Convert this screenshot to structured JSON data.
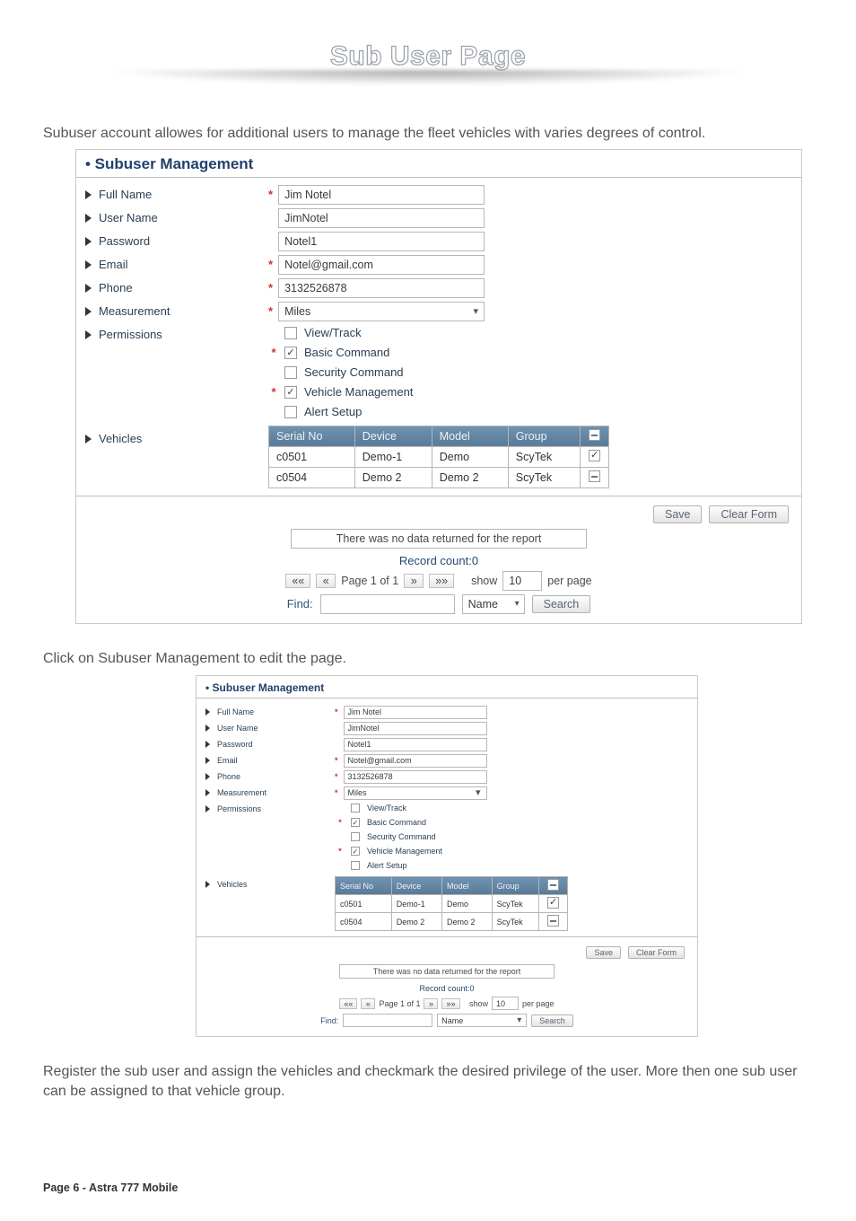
{
  "title": "Sub User Page",
  "intro": "Subuser account allowes for additional users to manage the fleet vehicles with varies degrees of control.",
  "mid_caption": "Click on Subuser Management to edit the page.",
  "outro": "Register the sub user and assign the vehicles and checkmark the desired privilege of the user. More then one sub user can be assigned to that vehicle group.",
  "footer": {
    "page_label": "Page 6  -  Astra 777 Mobile"
  },
  "shot": {
    "heading": "• Subuser Management",
    "fields": {
      "full_name": {
        "label": "Full Name",
        "value": "Jim Notel"
      },
      "user_name": {
        "label": "User Name",
        "value": "JimNotel"
      },
      "password": {
        "label": "Password",
        "value": "Notel1"
      },
      "email": {
        "label": "Email",
        "value": "Notel@gmail.com"
      },
      "phone": {
        "label": "Phone",
        "value": "3132526878"
      },
      "measurement": {
        "label": "Measurement",
        "value": "Miles"
      },
      "permissions_label": "Permissions"
    },
    "permissions": [
      {
        "label": "View/Track",
        "checked": false
      },
      {
        "label": "Basic Command",
        "checked": true
      },
      {
        "label": "Security Command",
        "checked": false
      },
      {
        "label": "Vehicle Management",
        "checked": true
      },
      {
        "label": "Alert Setup",
        "checked": false
      }
    ],
    "vehicles_label": "Vehicles",
    "vehicles": {
      "headers": {
        "serial": "Serial No",
        "device": "Device",
        "model": "Model",
        "group": "Group",
        "chk": ""
      },
      "rows": [
        {
          "serial": "c0501",
          "device": "Demo-1",
          "model": "Demo",
          "group": "ScyTek",
          "chk": "on"
        },
        {
          "serial": "c0504",
          "device": "Demo 2",
          "model": "Demo 2",
          "group": "ScyTek",
          "chk": "minus"
        }
      ]
    },
    "buttons": {
      "save": "Save",
      "clear": "Clear Form"
    },
    "message": "There was no data returned for the report",
    "record_count": "Record count:0",
    "pager": {
      "first": "««",
      "prev": "«",
      "label": "Page 1 of 1",
      "next": "»",
      "last": "»»",
      "show_label": "show",
      "show_value": "10",
      "per_page": "per page"
    },
    "find": {
      "label": "Find:",
      "input": "",
      "column": "Name",
      "search": "Search"
    }
  }
}
